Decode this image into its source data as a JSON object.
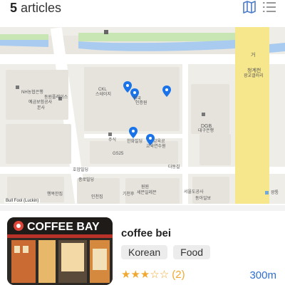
{
  "header": {
    "count": "5",
    "count_label": "articles",
    "map_icon": "map-icon",
    "list_icon": "list-icon"
  },
  "map": {
    "labels": {
      "teuk_sig_gwa": "거",
      "cheonggye_a": "청계천",
      "cheonggye_b": "광교갤러리",
      "nh_bank": "NH농협은행",
      "yegyo_a": "예금보험공사",
      "yegyo_b": "본사",
      "dongbu": "동원플레이스",
      "ckl_a": "CKL",
      "ckl_b": "스테이지",
      "hanguk_a": "한국",
      "hanguk_b": "인증원",
      "dgb_a": "DGB",
      "dgb_b": "대구은행",
      "jusik": "주식",
      "hanhwa": "한화빌딩",
      "gyoyuk_a": "교육공",
      "gyoyuk_b": "교육연수원",
      "gs25": "GS25",
      "hoam": "호암빌딩",
      "jongno_a": "종로빌딩",
      "inchon": "인천집",
      "haengbok": "행복한집",
      "gicheon": "기천후",
      "hwangwon": "원원",
      "sebel": "세븐일레븐",
      "seoul_a": "서울도공사",
      "dongha": "동아일보",
      "gwangtong": "광통",
      "street_a": "다동길",
      "attribution": "Bull Fool (Luckin)"
    }
  },
  "result": {
    "name": "coffee bei",
    "tags": [
      "Korean",
      "Food"
    ],
    "stars": "★★★☆☆",
    "rating": 3,
    "review_count": "(2)",
    "distance": "300m",
    "thumbnail_sign": "COFFEE BAY"
  },
  "colors": {
    "pin": "#1a73e8",
    "road_yellow": "#f6e68c",
    "water": "#a9cbf0",
    "park": "#bfe3a9",
    "accent": "#2f6fd0",
    "star": "#f0a830"
  }
}
